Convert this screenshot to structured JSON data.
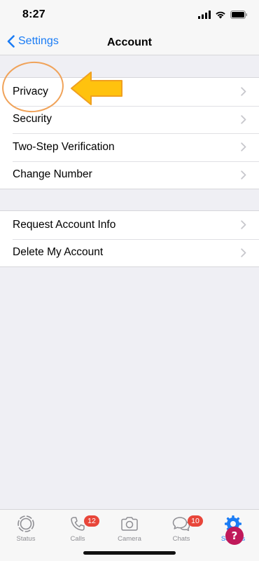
{
  "status_bar": {
    "time": "8:27"
  },
  "nav": {
    "back_label": "Settings",
    "title": "Account"
  },
  "groups": [
    {
      "rows": [
        {
          "label": "Privacy"
        },
        {
          "label": "Security"
        },
        {
          "label": "Two-Step Verification"
        },
        {
          "label": "Change Number"
        }
      ]
    },
    {
      "rows": [
        {
          "label": "Request Account Info"
        },
        {
          "label": "Delete My Account"
        }
      ]
    }
  ],
  "tab_bar": {
    "tabs": [
      {
        "label": "Status",
        "icon": "status-icon"
      },
      {
        "label": "Calls",
        "icon": "phone-icon",
        "badge": "12"
      },
      {
        "label": "Camera",
        "icon": "camera-icon"
      },
      {
        "label": "Chats",
        "icon": "chat-bubbles-icon",
        "badge": "10"
      },
      {
        "label": "Settings",
        "icon": "gear-icon",
        "active": true
      }
    ]
  },
  "colors": {
    "accent": "#1a7cf5",
    "badge": "#e8463a",
    "annotation_arrow": "#ffc20e",
    "annotation_circle": "#f0a35a"
  }
}
